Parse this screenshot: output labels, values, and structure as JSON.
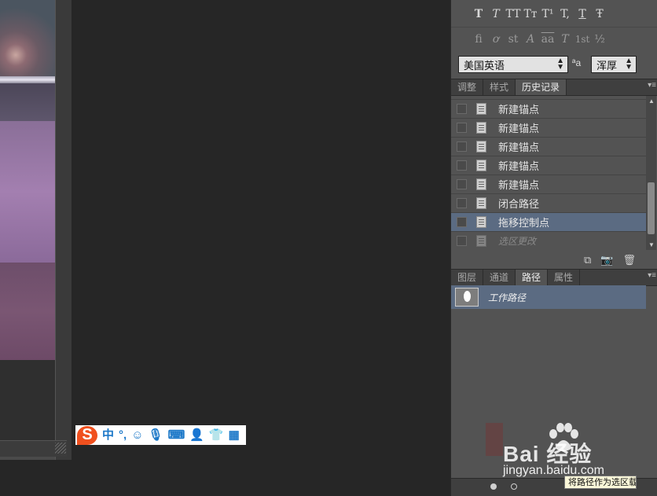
{
  "character_panel": {
    "typo_row1": [
      "T",
      "T",
      "TT",
      "Tт",
      "T¹",
      "T,",
      "T",
      "Ŧ"
    ],
    "typo_row2": [
      "fi",
      "ơ",
      "st",
      "A",
      "aa",
      "T",
      "1st",
      "½"
    ],
    "language": "美国英语",
    "aa_label": "ªa",
    "antialias": "浑厚"
  },
  "top_tabs": [
    "调整",
    "样式",
    "历史记录"
  ],
  "history_items": [
    {
      "label": "新建锚点",
      "state": "normal"
    },
    {
      "label": "新建锚点",
      "state": "normal"
    },
    {
      "label": "新建锚点",
      "state": "normal"
    },
    {
      "label": "新建锚点",
      "state": "normal"
    },
    {
      "label": "新建锚点",
      "state": "normal"
    },
    {
      "label": "闭合路径",
      "state": "normal"
    },
    {
      "label": "拖移控制点",
      "state": "selected"
    },
    {
      "label": "选区更改",
      "state": "dimmed"
    }
  ],
  "bottom_tabs": [
    "图层",
    "通道",
    "路径",
    "属性"
  ],
  "paths": [
    {
      "label": "工作路径"
    }
  ],
  "tooltip": "将路径作为选区载入",
  "ime_bar": {
    "logo": "S",
    "mode": "中",
    "punct": "°,",
    "icons": [
      "smiley-icon",
      "microphone-icon",
      "keyboard-icon",
      "user-icon",
      "shirt-icon",
      "grid-icon"
    ]
  },
  "watermark": {
    "brand": "Bai  经验",
    "url": "jingyan.baidu.com"
  },
  "colors": {
    "selection": "#5b6b82",
    "panel": "#535353",
    "workspace": "#262626",
    "ime_accent": "#f0501e"
  }
}
